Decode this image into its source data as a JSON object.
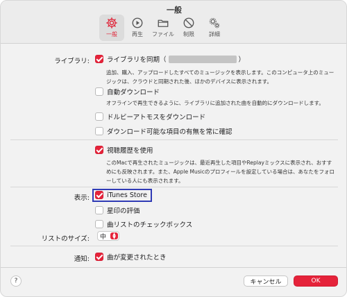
{
  "window": {
    "title": "一般"
  },
  "tabs": [
    {
      "label": "一般",
      "icon": "gear-icon",
      "active": true
    },
    {
      "label": "再生",
      "icon": "play-icon"
    },
    {
      "label": "ファイル",
      "icon": "folder-icon"
    },
    {
      "label": "制限",
      "icon": "restriction-icon"
    },
    {
      "label": "詳細",
      "icon": "gears-icon"
    }
  ],
  "library": {
    "section_label": "ライブラリ:",
    "sync": {
      "label_before": "ライブラリを同期（",
      "label_after": "）",
      "checked": true
    },
    "sync_desc": "追加、購入、アップロードしたすべてのミュージックを表示します。このコンピュータ上のミュージックは、クラウドと同期された後、ほかのデバイスに表示されます。",
    "auto_download": {
      "label": "自動ダウンロード",
      "checked": false
    },
    "auto_download_desc": "オフラインで再生できるように、ライブラリに追加された曲を自動的にダウンロードします。",
    "dolby": {
      "label": "ドルビーアトモスをダウンロード",
      "checked": false
    },
    "always_check": {
      "label": "ダウンロード可能な項目の有無を常に確認",
      "checked": false
    }
  },
  "history": {
    "label": "視聴履歴を使用",
    "checked": true,
    "desc": "このMacで再生されたミュージックは、最近再生した項目やReplayミックスに表示され、おすすめにも反映されます。また、Apple Musicのプロフィールを設定している場合は、あなたをフォローしている人にも表示されます。"
  },
  "display": {
    "section_label": "表示:",
    "itunes_store": {
      "label": "iTunes Store",
      "checked": true
    },
    "star_rating": {
      "label": "星印の評価",
      "checked": false
    },
    "song_checkbox": {
      "label": "曲リストのチェックボックス",
      "checked": false
    }
  },
  "list_size": {
    "label": "リストのサイズ:",
    "value": "中"
  },
  "notify": {
    "section_label": "通知:",
    "label": "曲が変更されたとき",
    "checked": true
  },
  "footer": {
    "help": "?",
    "cancel": "キャンセル",
    "ok": "OK"
  },
  "colors": {
    "accent": "#e5233a",
    "highlight_box": "#2f3ab5"
  }
}
